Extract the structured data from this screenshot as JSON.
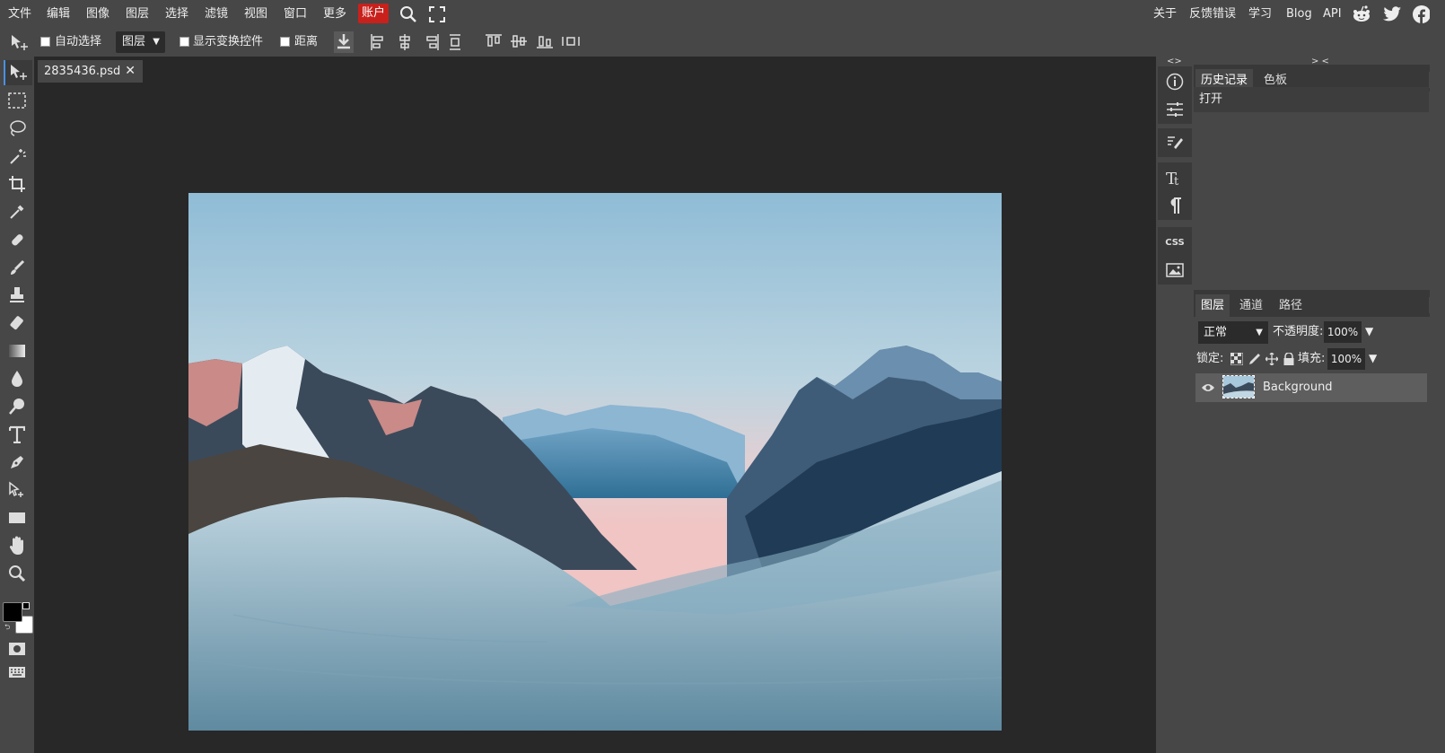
{
  "menu": {
    "items": [
      "文件",
      "编辑",
      "图像",
      "图层",
      "选择",
      "滤镜",
      "视图",
      "窗口",
      "更多"
    ],
    "account_label": "账户",
    "right_links": [
      "关于",
      "反馈错误",
      "学习",
      "Blog",
      "API"
    ],
    "social_icons": [
      "reddit-icon",
      "twitter-icon",
      "facebook-icon"
    ],
    "account_color": "#c8211c"
  },
  "options": {
    "auto_select_label": "自动选择",
    "layer_select_value": "图层",
    "show_transform_label": "显示变换控件",
    "distance_label": "距离",
    "auto_select_checked": false,
    "show_transform_checked": false,
    "distance_checked": false
  },
  "document": {
    "tab_name": "2835436.psd",
    "close_symbol": "✕"
  },
  "toolbar": {
    "tools": [
      "move-tool",
      "marquee-tool",
      "lasso-tool",
      "magic-wand-tool",
      "crop-tool",
      "eyedropper-tool",
      "healing-tool",
      "brush-tool",
      "stamp-tool",
      "eraser-tool",
      "gradient-tool",
      "blur-tool",
      "dodge-tool",
      "type-tool",
      "pen-tool",
      "path-select-tool",
      "shape-tool",
      "hand-tool",
      "zoom-tool"
    ],
    "foreground_color": "#000000",
    "background_color": "#ffffff"
  },
  "mini_panel": {
    "collapse_label": "<>",
    "expand_label": "> <",
    "css_label": "CSS"
  },
  "history_panel": {
    "tabs": [
      "历史记录",
      "色板"
    ],
    "entries": [
      "打开"
    ]
  },
  "layers_panel": {
    "tabs": [
      "图层",
      "通道",
      "路径"
    ],
    "blend_mode": "正常",
    "opacity_label": "不透明度:",
    "opacity_value": "100%",
    "lock_label": "锁定:",
    "fill_label": "填充:",
    "fill_value": "100%",
    "layers": [
      {
        "name": "Background",
        "visible": true
      }
    ]
  }
}
